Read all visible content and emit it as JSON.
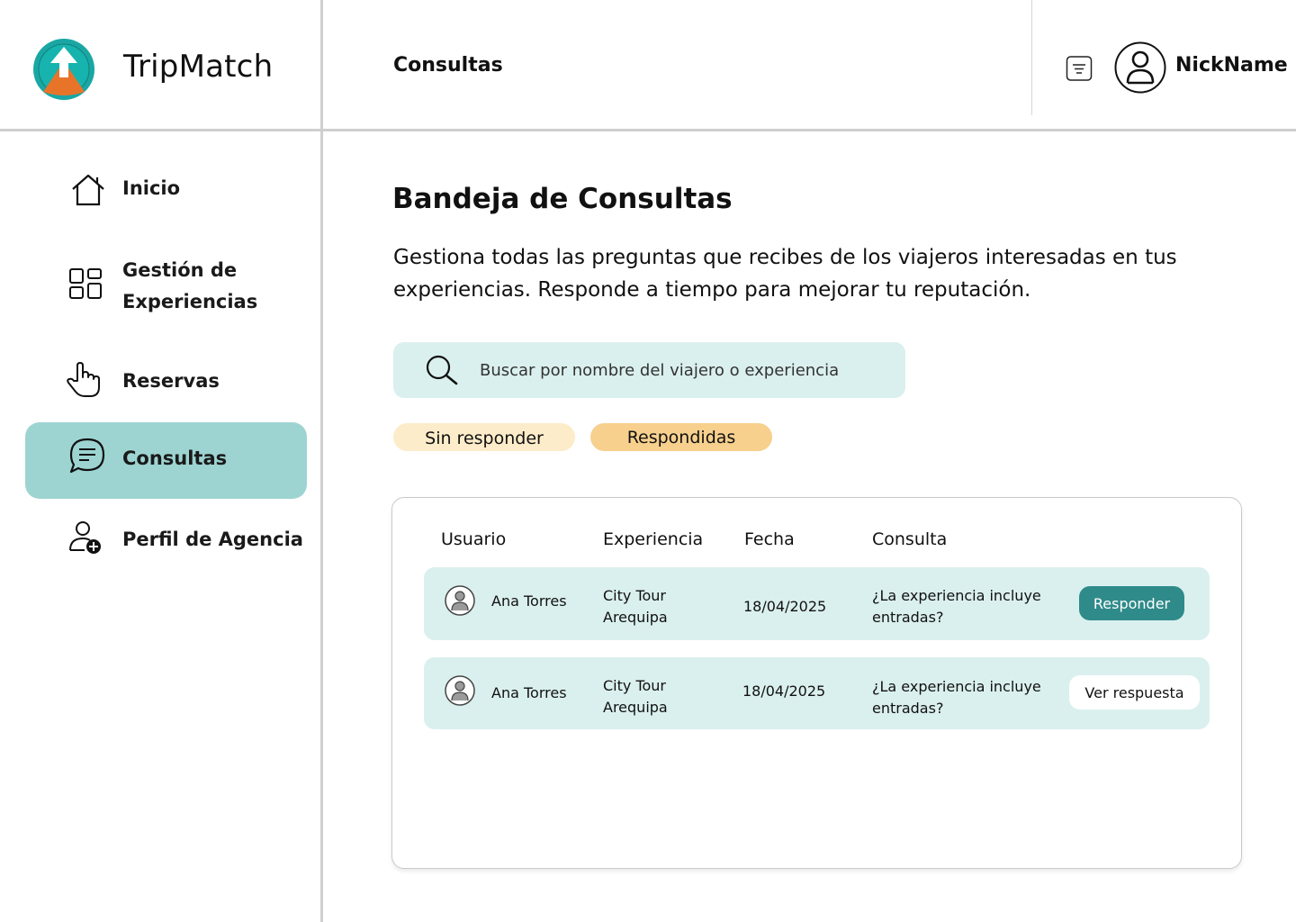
{
  "app": {
    "name": "TripMatch"
  },
  "header": {
    "title": "Consultas",
    "user_name": "NickName"
  },
  "sidebar": {
    "items": [
      {
        "label": "Inicio",
        "icon": "home-icon"
      },
      {
        "label": "Gestión de Experiencias",
        "icon": "dashboard-grid-icon"
      },
      {
        "label": "Reservas",
        "icon": "hand-pointer-icon"
      },
      {
        "label": "Consultas",
        "icon": "chat-bubble-icon",
        "active": true
      },
      {
        "label": "Perfil de Agencia",
        "icon": "user-add-icon"
      }
    ]
  },
  "main": {
    "title": "Bandeja de Consultas",
    "description": "Gestiona todas las preguntas que recibes de los viajeros interesadas en tus experiencias. Responde a tiempo para mejorar tu reputación.",
    "search": {
      "placeholder": "Buscar por nombre del viajero o experiencia"
    },
    "filters": [
      {
        "label": "Sin responder"
      },
      {
        "label": "Respondidas",
        "active": true
      }
    ],
    "table": {
      "headers": [
        "Usuario",
        "Experiencia",
        "Fecha",
        "Consulta"
      ],
      "rows": [
        {
          "user": "Ana Torres",
          "experience": "City Tour Arequipa",
          "date": "18/04/2025",
          "query": "¿La experiencia incluye entradas?",
          "action": "Responder"
        },
        {
          "user": "Ana Torres",
          "experience": "City Tour Arequipa",
          "date": "18/04/2025",
          "query": "¿La experiencia incluye entradas?",
          "action": "Ver respuesta"
        }
      ]
    }
  },
  "colors": {
    "accent": "#2f8b8a",
    "active_nav": "#9dd4d2",
    "row_bg": "#daf0ee",
    "chip_pending": "#fdecca",
    "chip_answered": "#f7d08d",
    "logo_teal": "#1aa7a4",
    "logo_orange": "#e8742a"
  }
}
